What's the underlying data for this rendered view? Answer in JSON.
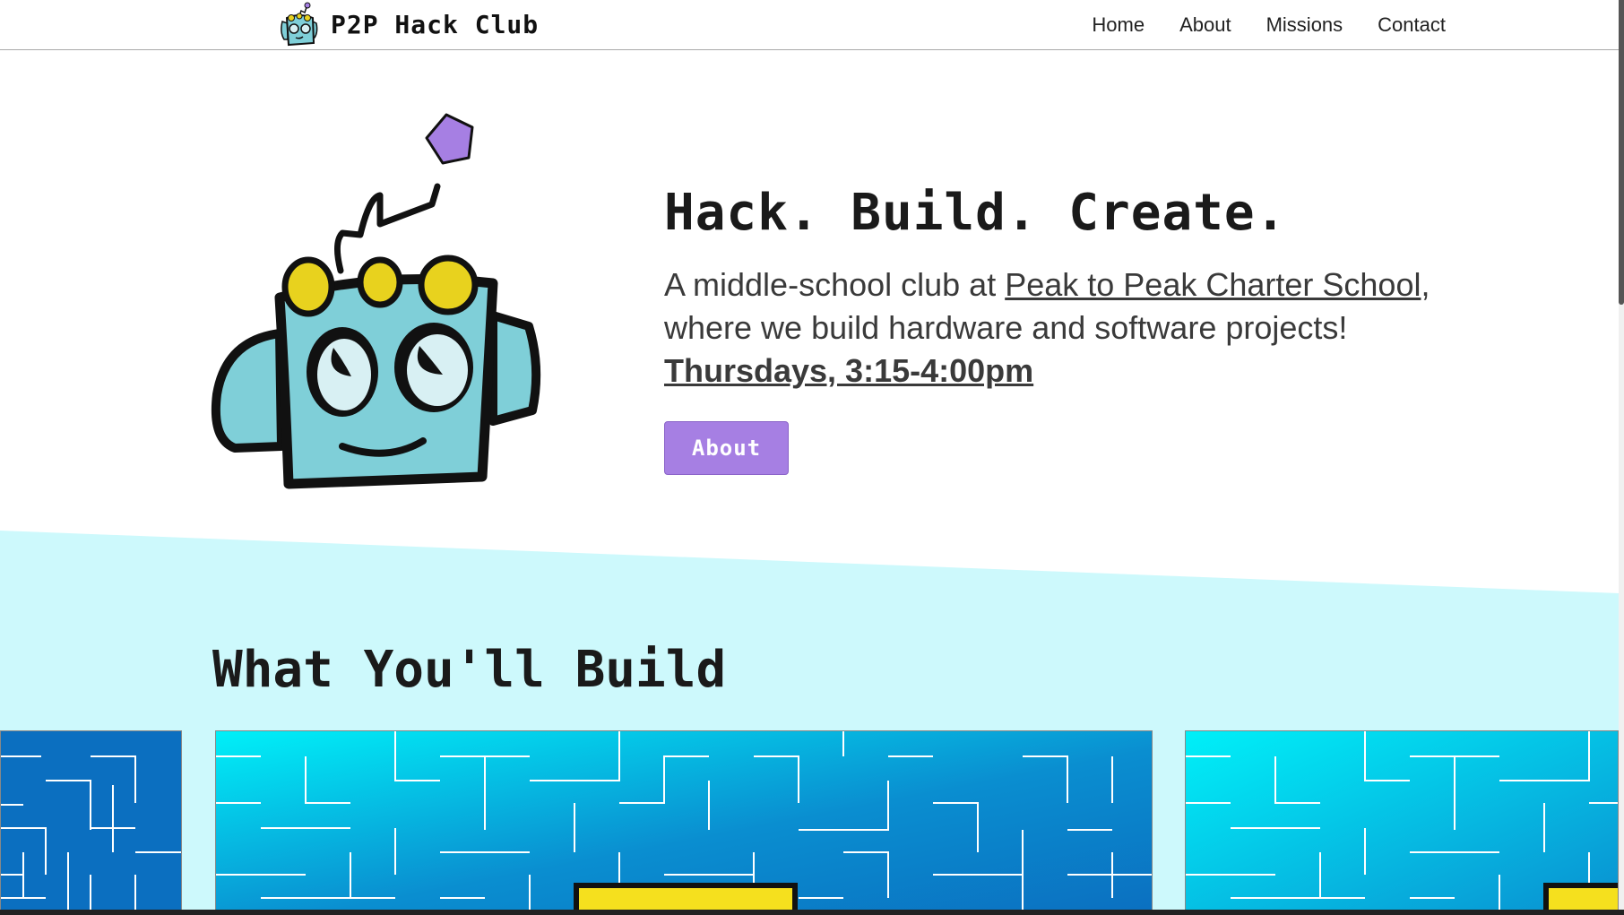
{
  "header": {
    "brand_name": "P2P Hack Club",
    "nav": [
      "Home",
      "About",
      "Missions",
      "Contact"
    ]
  },
  "hero": {
    "title": "Hack. Build. Create.",
    "desc_prefix": "A middle-school club at ",
    "school_link": "Peak to Peak Charter School",
    "desc_suffix": ", where we build hardware and software projects!",
    "schedule": "Thursdays, 3:15-4:00pm",
    "about_button": "About"
  },
  "section": {
    "title": "What You'll Build"
  },
  "colors": {
    "accent_purple": "#a67fe3",
    "section_bg": "#cdf9fc",
    "robot_blue": "#7fcfd8",
    "robot_yellow": "#e8d21e",
    "maze_dark": "#0b6fc0",
    "maze_light": "#00f0f8"
  }
}
